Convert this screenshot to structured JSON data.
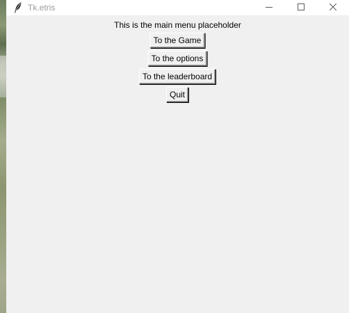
{
  "window": {
    "title": "Tk.etris",
    "app_icon": "feather-icon",
    "controls": {
      "minimize_icon": "minimize-icon",
      "maximize_icon": "maximize-icon",
      "close_icon": "close-icon"
    }
  },
  "main_menu": {
    "placeholder_text": "This is the main menu placeholder",
    "buttons": [
      {
        "label": "To the Game"
      },
      {
        "label": "To the options"
      },
      {
        "label": "To the leaderboard"
      },
      {
        "label": "Quit"
      }
    ]
  },
  "colors": {
    "window_background": "#f0f0f0",
    "titlebar_background": "#ffffff",
    "title_text": "#9a9a9a",
    "button_text": "#000000"
  }
}
